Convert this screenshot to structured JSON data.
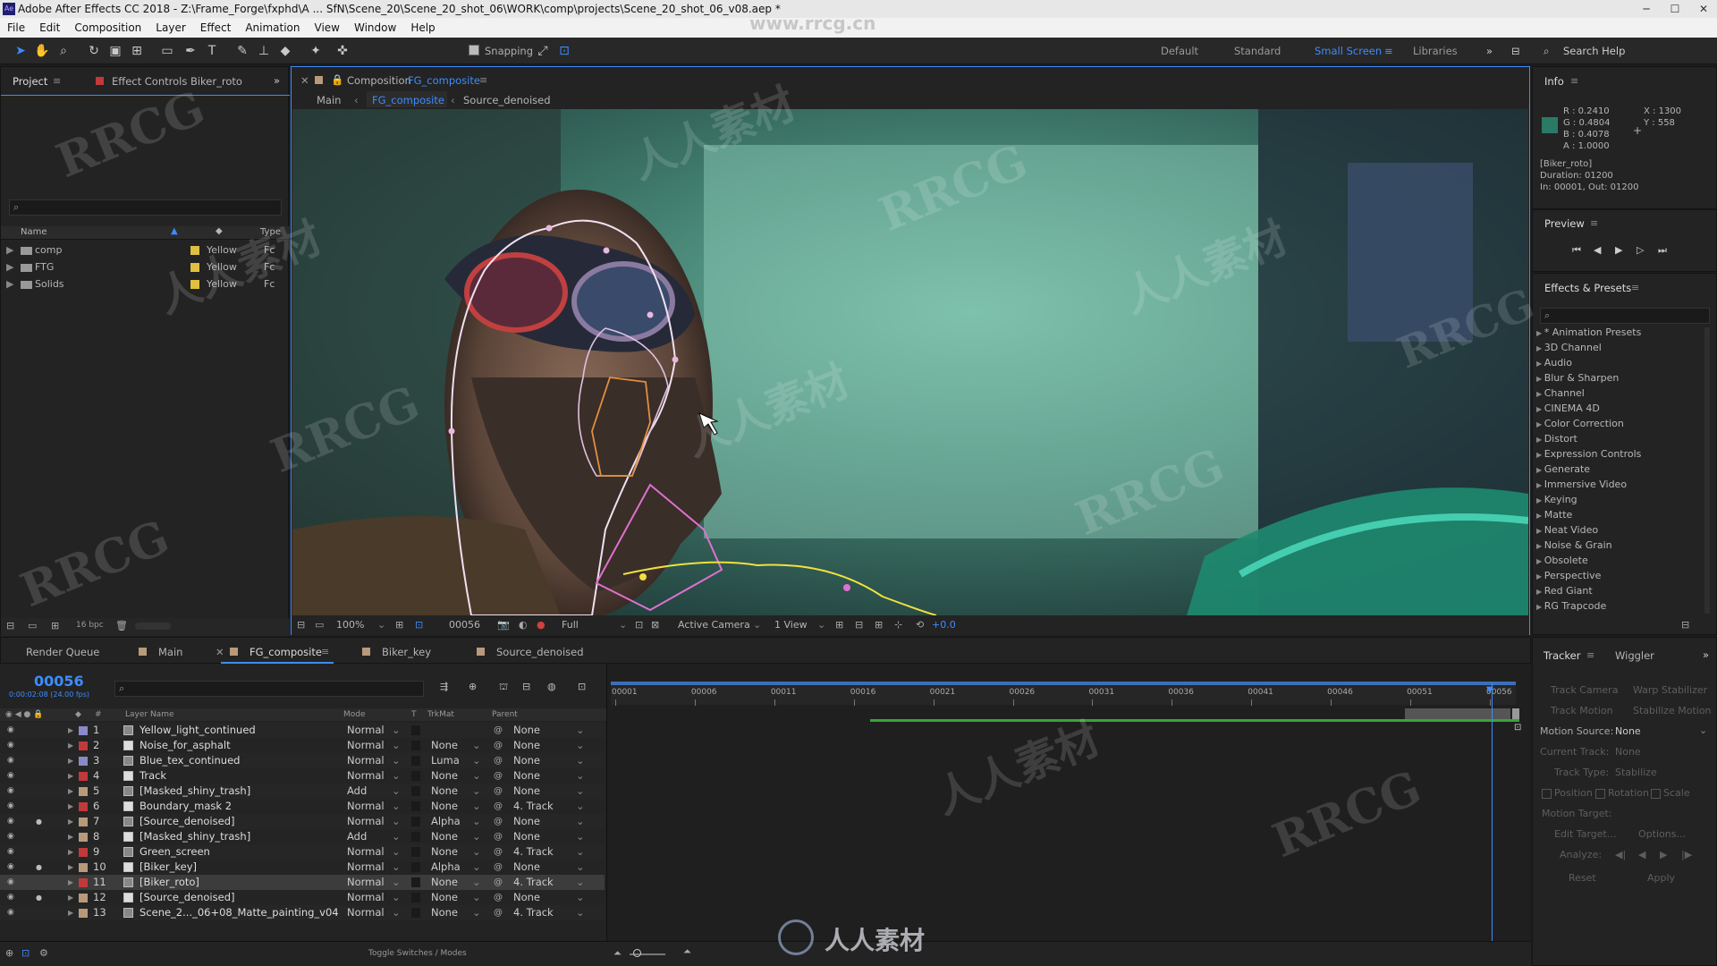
{
  "window": {
    "title": "Adobe After Effects CC 2018 - Z:\\Frame_Forge\\fxphd\\A ... SfN\\Scene_20\\Scene_20_shot_06\\WORK\\comp\\projects\\Scene_20_shot_06_v08.aep *"
  },
  "menu": [
    "File",
    "Edit",
    "Composition",
    "Layer",
    "Effect",
    "Animation",
    "View",
    "Window",
    "Help"
  ],
  "toolbar": {
    "snapping": "Snapping",
    "workspaces": [
      "Default",
      "Standard",
      "Small Screen",
      "Libraries"
    ],
    "search_help": "Search Help"
  },
  "project": {
    "tab": "Project",
    "effect_controls": "Effect Controls Biker_roto",
    "col_name": "Name",
    "col_type": "Type",
    "items": [
      {
        "name": "comp",
        "label": "Yellow",
        "type": "Fc"
      },
      {
        "name": "FTG",
        "label": "Yellow",
        "type": "Fc"
      },
      {
        "name": "Solids",
        "label": "Yellow",
        "type": "Fc"
      }
    ],
    "bpc": "16 bpc"
  },
  "comp": {
    "prefix": "Composition",
    "name": "FG_composite",
    "breadcrumbs": [
      "Main",
      "FG_composite",
      "Source_denoised"
    ],
    "zoom": "100%",
    "frame": "00056",
    "resolution": "Full",
    "camera": "Active Camera",
    "views": "1 View",
    "exposure": "+0.0"
  },
  "info": {
    "title": "Info",
    "r": "R : 0.2410",
    "g": "G : 0.4804",
    "b": "B : 0.4078",
    "a": "A : 1.0000",
    "x": "X : 1300",
    "y": "Y : 558",
    "layer": "[Biker_roto]",
    "duration": "Duration: 01200",
    "inout": "In: 00001, Out: 01200",
    "swatch": "#2a7a66"
  },
  "preview": {
    "title": "Preview"
  },
  "effects": {
    "title": "Effects & Presets",
    "items": [
      "* Animation Presets",
      "3D Channel",
      "Audio",
      "Blur & Sharpen",
      "Channel",
      "CINEMA 4D",
      "Color Correction",
      "Distort",
      "Expression Controls",
      "Generate",
      "Immersive Video",
      "Keying",
      "Matte",
      "Neat Video",
      "Noise & Grain",
      "Obsolete",
      "Perspective",
      "Red Giant",
      "RG Trapcode"
    ]
  },
  "timeline": {
    "tabs": [
      "Render Queue",
      "Main",
      "FG_composite",
      "Biker_key",
      "Source_denoised"
    ],
    "current_time": "00056",
    "timecode_sub": "0:00:02:08 (24.00 fps)",
    "col_layer": "Layer Name",
    "col_mode": "Mode",
    "col_t": "T",
    "col_trkmat": "TrkMat",
    "col_parent": "Parent",
    "ruler": [
      "00001",
      "00006",
      "00011",
      "00016",
      "00021",
      "00026",
      "00031",
      "00036",
      "00041",
      "00046",
      "00051",
      "00056"
    ],
    "toggle": "Toggle Switches / Modes",
    "layers": [
      {
        "num": "1",
        "name": "Yellow_light_continued",
        "mode": "Normal",
        "trkmat": "",
        "parent": "None",
        "color": "#8a8ac8",
        "bar": "#7b7ea6"
      },
      {
        "num": "2",
        "name": "Noise_for_asphalt",
        "mode": "Normal",
        "trkmat": "None",
        "parent": "None",
        "color": "#c03a3a",
        "bar": "#a84b4b"
      },
      {
        "num": "3",
        "name": "Blue_tex_continued",
        "mode": "Normal",
        "trkmat": "Luma",
        "parent": "None",
        "color": "#8a8ac8",
        "bar": "#7b7ea6"
      },
      {
        "num": "4",
        "name": "Track",
        "mode": "Normal",
        "trkmat": "None",
        "parent": "None",
        "color": "#c03a3a",
        "bar": "#a84b4b"
      },
      {
        "num": "5",
        "name": "[Masked_shiny_trash]",
        "mode": "Add",
        "trkmat": "None",
        "parent": "None",
        "color": "#b89a7a",
        "bar": "#9f8a72"
      },
      {
        "num": "6",
        "name": "Boundary_mask 2",
        "mode": "Normal",
        "trkmat": "None",
        "parent": "4. Track",
        "color": "#c03a3a",
        "bar": "#a84b4b"
      },
      {
        "num": "7",
        "name": "[Source_denoised]",
        "mode": "Normal",
        "trkmat": "Alpha",
        "parent": "None",
        "color": "#b89a7a",
        "bar": "#9f8a72"
      },
      {
        "num": "8",
        "name": "[Masked_shiny_trash]",
        "mode": "Add",
        "trkmat": "None",
        "parent": "None",
        "color": "#b89a7a",
        "bar": "#9f8a72"
      },
      {
        "num": "9",
        "name": "Green_screen",
        "mode": "Normal",
        "trkmat": "None",
        "parent": "4. Track",
        "color": "#c03a3a",
        "bar": "#a84b4b"
      },
      {
        "num": "10",
        "name": "[Biker_key]",
        "mode": "Normal",
        "trkmat": "Alpha",
        "parent": "None",
        "color": "#b89a7a",
        "bar": "#9f8a72"
      },
      {
        "num": "11",
        "name": "[Biker_roto]",
        "mode": "Normal",
        "trkmat": "None",
        "parent": "4. Track",
        "color": "#c03a3a",
        "bar": "#b04040"
      },
      {
        "num": "12",
        "name": "[Source_denoised]",
        "mode": "Normal",
        "trkmat": "None",
        "parent": "None",
        "color": "#b89a7a",
        "bar": "#9f8a72"
      },
      {
        "num": "13",
        "name": "Scene_2..._06+08_Matte_painting_v04",
        "mode": "Normal",
        "trkmat": "None",
        "parent": "4. Track",
        "color": "#b89a7a",
        "bar": "#9f8a72"
      }
    ]
  },
  "tracker": {
    "tabs": [
      "Tracker",
      "Wiggler"
    ],
    "track_camera": "Track Camera",
    "warp_stabilizer": "Warp Stabilizer",
    "track_motion": "Track Motion",
    "stabilize_motion": "Stabilize Motion",
    "motion_source": "Motion Source:",
    "motion_source_val": "None",
    "current_track": "Current Track:",
    "current_track_val": "None",
    "track_type": "Track Type:",
    "track_type_val": "Stabilize",
    "position": "Position",
    "rotation": "Rotation",
    "scale": "Scale",
    "motion_target": "Motion Target:",
    "edit_target": "Edit Target...",
    "options": "Options...",
    "analyze": "Analyze:",
    "reset": "Reset",
    "apply": "Apply"
  },
  "watermarks": [
    "RRCG",
    "人人素材",
    "RRCG",
    "人人素材",
    "RRCG",
    "人人素材",
    "RRCG",
    "人人素材",
    "RRCG",
    "RRCG",
    "人人素材",
    "RRCG"
  ],
  "bottom_logo": "人人素材",
  "site_watermark": "www.rrcg.cn"
}
